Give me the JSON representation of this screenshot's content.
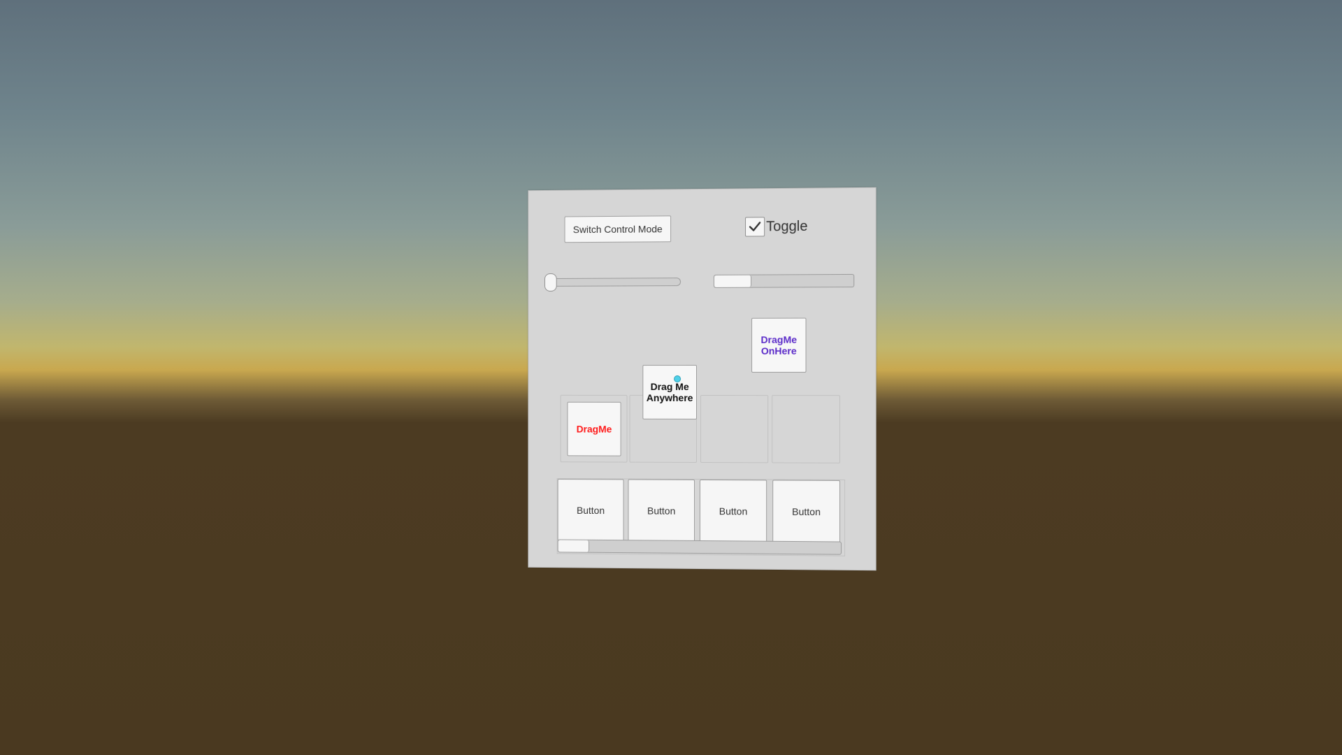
{
  "panel": {
    "switch_button_label": "Switch Control Mode",
    "toggle": {
      "label": "Toggle",
      "checked": true
    },
    "slider": {
      "value": 0.0
    },
    "top_scrollbar": {
      "position": 0.0,
      "thumb_size": 0.27
    },
    "drag_tiles": [
      {
        "label": "DragMe",
        "color": "#ff1a1a"
      },
      {
        "label": "Drag Me Anywhere",
        "color": "#111111"
      },
      {
        "label": "DragMe OnHere",
        "color": "#5b2bc9"
      }
    ],
    "scroll_view": {
      "buttons": [
        "Button",
        "Button",
        "Button",
        "Button"
      ],
      "scrollbar": {
        "position": 0.0,
        "thumb_size": 0.11
      }
    }
  },
  "colors": {
    "panel_bg": "#d6d6d6",
    "control_bg": "#f6f6f6",
    "cursor": "#4fd0e8"
  }
}
